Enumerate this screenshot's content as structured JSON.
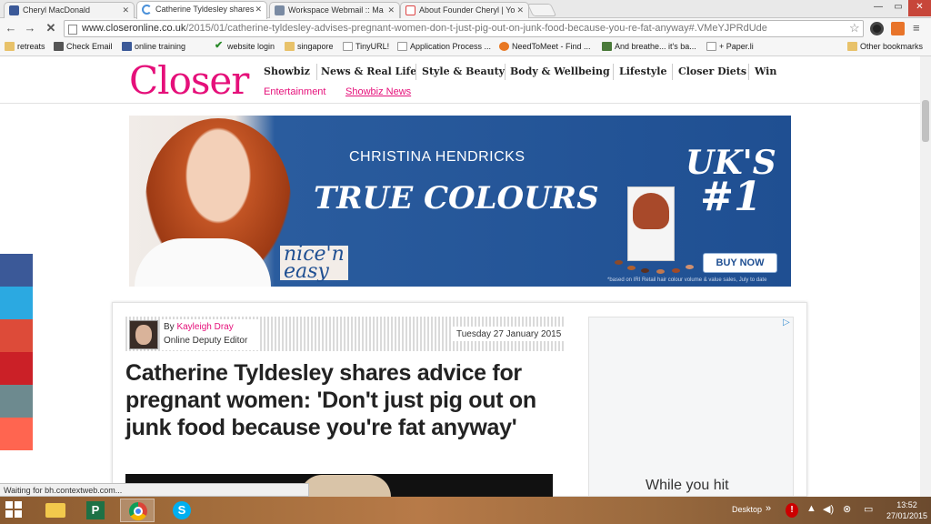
{
  "browser": {
    "tabs": [
      {
        "label": "Cheryl MacDonald",
        "active": false,
        "icon": "facebook-icon"
      },
      {
        "label": "Catherine Tyldesley shares",
        "active": true,
        "icon": "loading-icon"
      },
      {
        "label": "Workspace Webmail :: Ma",
        "active": false,
        "icon": "mail-icon"
      },
      {
        "label": "About Founder Cheryl | Yo",
        "active": false,
        "icon": "gmail-icon"
      }
    ],
    "url_host": "www.closeronline.co.uk",
    "url_path": "/2015/01/catherine-tyldesley-advises-pregnant-women-don-t-just-pig-out-on-junk-food-because-you-re-fat-anyway#.VMeYJPRdUde",
    "bookmarks": [
      {
        "label": "retreats",
        "icon": "folder-icon"
      },
      {
        "label": "Check Email",
        "icon": "mail-icon"
      },
      {
        "label": "online training",
        "icon": "facebook-icon"
      },
      {
        "label": "website login",
        "icon": "check-icon"
      },
      {
        "label": "singapore",
        "icon": "folder-icon"
      },
      {
        "label": "TinyURL!",
        "icon": "page-icon"
      },
      {
        "label": "Application Process ...",
        "icon": "page-icon"
      },
      {
        "label": "NeedToMeet - Find ...",
        "icon": "orange-icon"
      },
      {
        "label": "And breathe... it's ba...",
        "icon": "page-icon"
      },
      {
        "label": "+ Paper.li",
        "icon": "page-icon"
      },
      {
        "label": "Other bookmarks",
        "icon": "folder-icon"
      }
    ],
    "status": "Waiting for bh.contextweb.com..."
  },
  "site": {
    "logo": "Closer",
    "nav": [
      "Showbiz",
      "News & Real Life",
      "Style & Beauty",
      "Body & Wellbeing",
      "Lifestyle",
      "Closer Diets",
      "Win"
    ],
    "subnav": [
      "Entertainment",
      "Showbiz News"
    ]
  },
  "ad": {
    "subtitle": "CHRISTINA HENDRICKS",
    "title": "TRUE COLOURS",
    "uk_line1": "UK'S",
    "uk_line2": "#1",
    "brand_line1": "nice'n",
    "brand_line2": "easy",
    "cta": "BUY NOW",
    "footnote": "*based on IRI Retail hair colour volume & value sales, July to date"
  },
  "article": {
    "by_prefix": "By ",
    "author": "Kayleigh Dray",
    "role": "Online Deputy Editor",
    "date": "Tuesday 27 January 2015",
    "headline": "Catherine Tyldesley shares advice for pregnant women: 'Don't just pig out on junk food because you're fat anyway'"
  },
  "side_ad": {
    "text": "While you hit",
    "choices_icon": "▷"
  },
  "social_colors": [
    "#3b5998",
    "#2ba9e1",
    "#dd4b39",
    "#cb2027",
    "#6d8a8f",
    "#ff6550"
  ],
  "taskbar": {
    "desktop_label": "Desktop",
    "time": "13:52",
    "date": "27/01/2015"
  },
  "colors": {
    "brand": "#e5107a"
  }
}
